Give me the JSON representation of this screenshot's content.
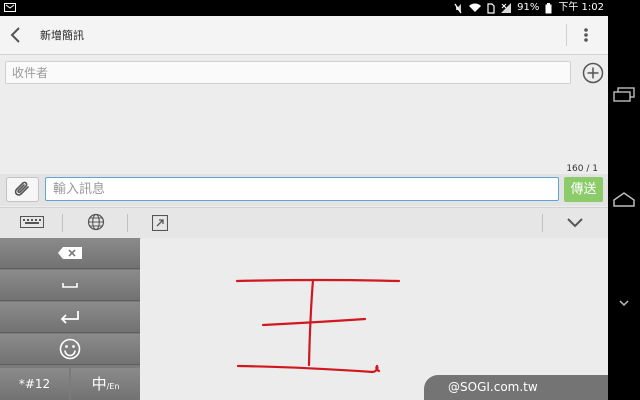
{
  "status_bar": {
    "battery_percent": "91%",
    "time": "下午 1:02"
  },
  "header": {
    "title": "新增簡訊"
  },
  "recipient": {
    "placeholder": "收件者"
  },
  "compose": {
    "counter": "160 / 1",
    "placeholder": "輸入訊息",
    "send_label": "傳送"
  },
  "keyboard": {
    "symbols_label": "*#12",
    "lang_main": "中",
    "lang_sub": "/En"
  },
  "watermark": {
    "text": "@SOGI.com.tw"
  },
  "colors": {
    "send_button": "#8ccb6a",
    "input_border": "#5aa7d6",
    "ink": "#d0181e"
  },
  "icons": {
    "back": "chevron-left-icon",
    "menu": "overflow-menu-icon",
    "add": "plus-circle-icon",
    "attach": "paperclip-icon",
    "keyboard": "keyboard-icon",
    "globe": "globe-icon",
    "expand": "expand-icon",
    "collapse": "chevron-down-icon",
    "backspace": "backspace-icon",
    "space": "space-icon",
    "enter": "enter-icon",
    "emoji": "smiley-icon"
  }
}
